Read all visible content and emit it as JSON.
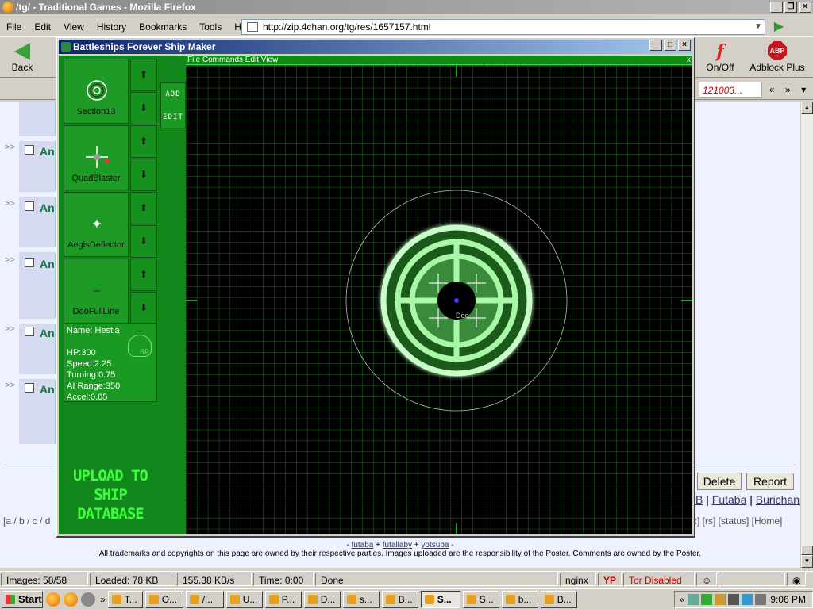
{
  "browser": {
    "title": "/tg/ - Traditional Games - Mozilla Firefox",
    "menu": [
      "File",
      "Edit",
      "View",
      "History",
      "Bookmarks",
      "Tools",
      "Help"
    ],
    "url": "http://zip.4chan.org/tg/res/1657157.html",
    "back_label": "Back",
    "onoff_label": "On/Off",
    "adblock_label": "Adblock Plus",
    "adblock_badge": "ABP",
    "bookmark_link": "121003...",
    "chev_left": "«",
    "chev_right": "»"
  },
  "page": {
    "post_marker": ">>",
    "post_name": "An",
    "delete_label": "Delete",
    "report_label": "Report",
    "boards_right_1": "B",
    "boards_right_2": "Futaba",
    "boards_right_3": "Burichan",
    "nav_left": "[a / b / c / d",
    "nav_right": "x] [rs] [status]   [Home]",
    "footer_links": [
      "futaba",
      "futallaby",
      "yotsuba"
    ],
    "footer_copyright": "All trademarks and copyrights on this page are owned by their respective parties. Images uploaded are the responsibility of the Poster. Comments are owned by the Poster."
  },
  "ship_maker": {
    "title": "Battleships Forever Ship Maker",
    "canvas_menu": "File Commands Edit View",
    "canvas_close": "x",
    "add_label": "ADD",
    "edit_label": "EDIT",
    "parts": [
      {
        "name": "Section13",
        "icon": "target-ring-icon"
      },
      {
        "name": "QuadBlaster",
        "icon": "quad-blaster-icon"
      },
      {
        "name": "AegisDeflector",
        "icon": "deflector-icon"
      },
      {
        "name": "DooFullLine",
        "icon": "line-icon"
      }
    ],
    "ship": {
      "name_label": "Name: Hestia",
      "hp": "HP:300",
      "speed": "Speed:2.25",
      "turning": "Turning:0.75",
      "ai_range": "AI Range:350",
      "accel": "Accel:0.05",
      "bp_badge": "BP"
    },
    "upload_label": "UPLOAD TO SHIP DATABASE",
    "canvas_label": "Dee"
  },
  "statusbar": {
    "images": "Images: 58/58",
    "loaded": "Loaded: 78 KB",
    "speed": "155.38 KB/s",
    "time": "Time: 0:00",
    "state": "Done",
    "server": "nginx",
    "yp": "YP",
    "tor": "Tor Disabled"
  },
  "taskbar": {
    "start": "Start",
    "items": [
      "T...",
      "O...",
      "/...",
      "U...",
      "P...",
      "D...",
      "s...",
      "B...",
      "S...",
      "S...",
      "b...",
      "B..."
    ],
    "chev": "«",
    "clock": "9:06 PM"
  },
  "colors": {
    "accent_green": "#11861a",
    "grid_green": "#1f6e1f",
    "glow_green": "#7eff7e"
  }
}
